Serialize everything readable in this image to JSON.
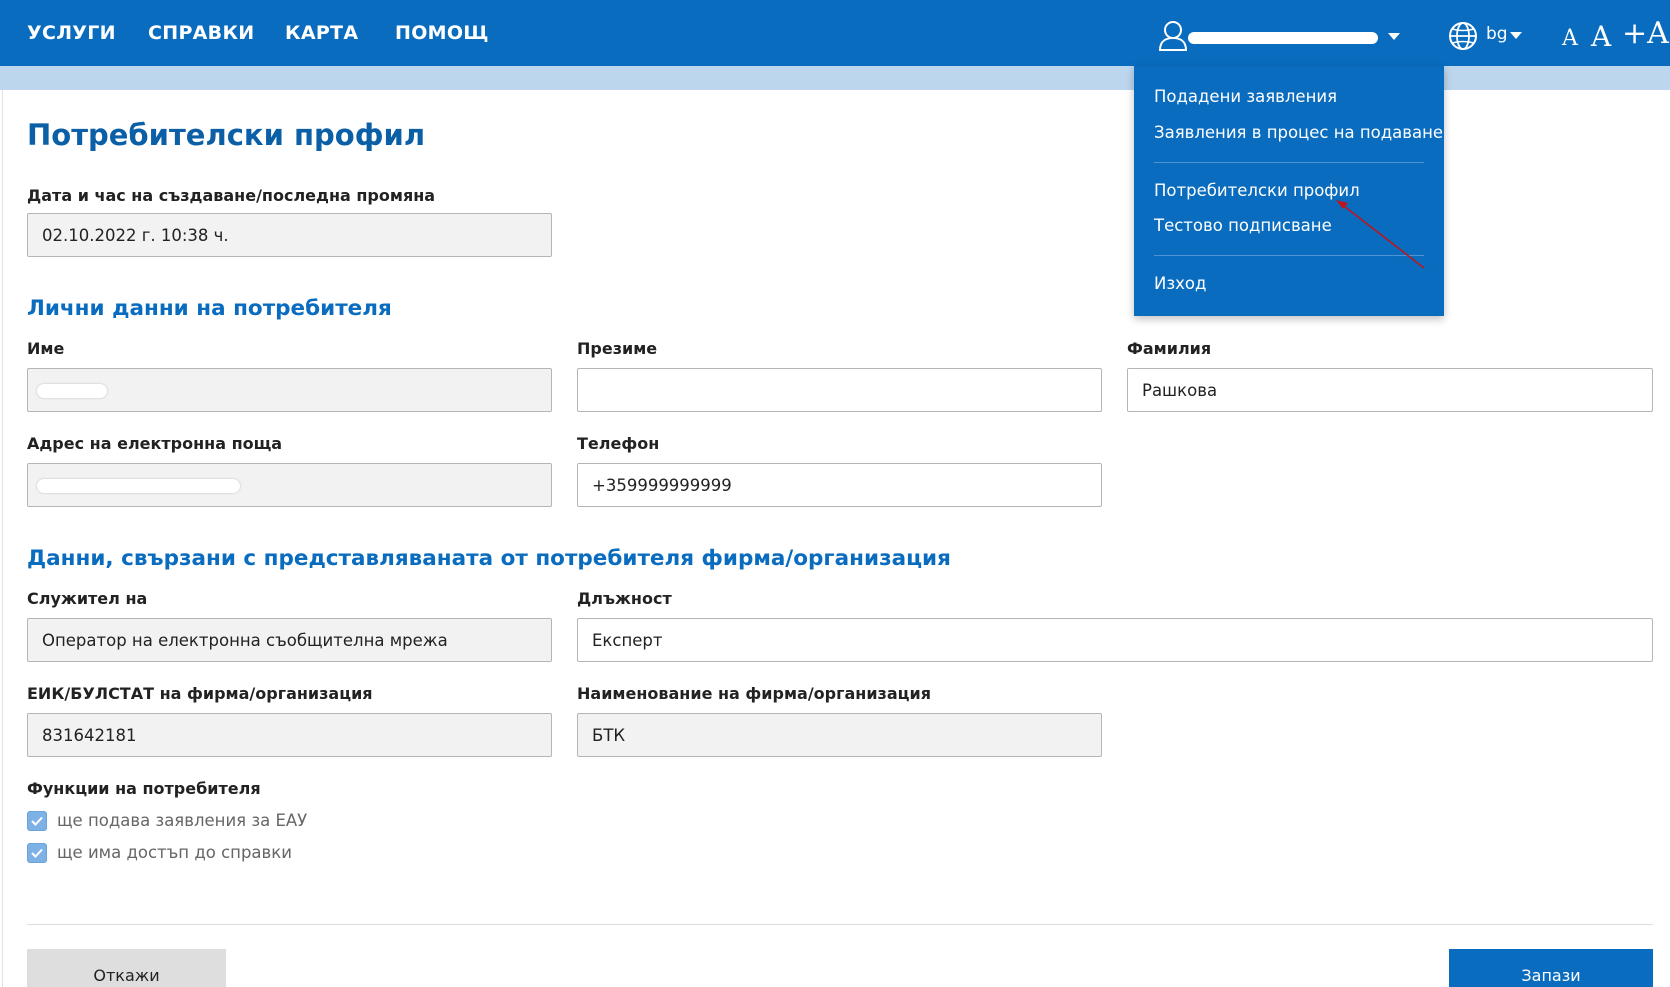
{
  "nav": {
    "items": [
      "УСЛУГИ",
      "СПРАВКИ",
      "КАРТА",
      "ПОМОЩ"
    ],
    "user_name": "",
    "language": "bg",
    "font_sizes": [
      "A",
      "A",
      "+A"
    ]
  },
  "dropdown": {
    "items": [
      "Подадени заявления",
      "Заявления в процес на подаване",
      "Потребителски профил",
      "Тестово подписване",
      "Изход"
    ]
  },
  "page": {
    "title": "Потребителски профил",
    "created_label": "Дата и час на създаване/последна промяна",
    "created_value": "02.10.2022 г. 10:38 ч."
  },
  "personal": {
    "section_title": "Лични данни на потребителя",
    "first_name_label": "Име",
    "first_name_value": "",
    "middle_name_label": "Презиме",
    "middle_name_value": "",
    "last_name_label": "Фамилия",
    "last_name_value": "Рашкова",
    "email_label": "Адрес на електронна поща",
    "email_value": "",
    "phone_label": "Телефон",
    "phone_value": "+359999999999"
  },
  "company": {
    "section_title": "Данни, свързани с представляваната от потребителя фирма/организация",
    "employee_label": "Служител на",
    "employee_value": "Оператор на електронна съобщителна мрежа",
    "position_label": "Длъжност",
    "position_value": "Експерт",
    "eik_label": "ЕИК/БУЛСТАТ на фирма/организация",
    "eik_value": "831642181",
    "name_label": "Наименование на фирма/организация",
    "name_value": "БТК"
  },
  "functions": {
    "label": "Функции на потребителя",
    "options": [
      {
        "label": "ще подава заявления за ЕАУ",
        "checked": true
      },
      {
        "label": "ще има достъп до справки",
        "checked": true
      }
    ]
  },
  "actions": {
    "cancel": "Откажи",
    "save": "Запази"
  },
  "colors": {
    "primary": "#0a6cbf",
    "title": "#0a5fa6",
    "band": "#bcd6ee",
    "checkbox": "#7eb2e4",
    "annotation_arrow": "#c0141c"
  }
}
